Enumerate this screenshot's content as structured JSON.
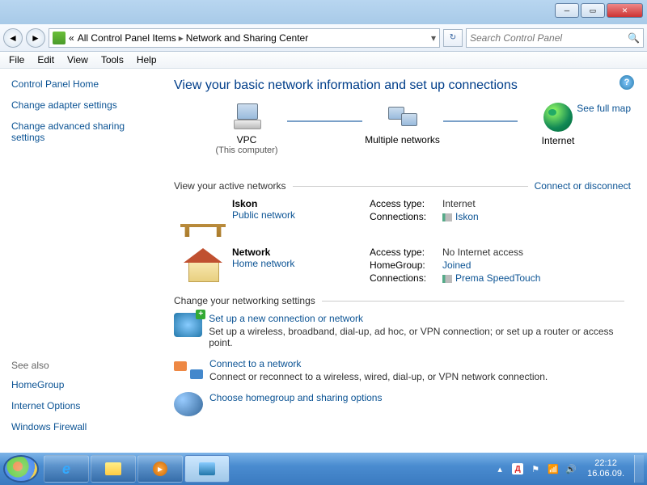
{
  "window": {
    "breadcrumb_prefix": "«",
    "breadcrumb_1": "All Control Panel Items",
    "breadcrumb_sep": "▸",
    "breadcrumb_2": "Network and Sharing Center",
    "search_placeholder": "Search Control Panel"
  },
  "menu": {
    "file": "File",
    "edit": "Edit",
    "view": "View",
    "tools": "Tools",
    "help": "Help"
  },
  "sidebar": {
    "home": "Control Panel Home",
    "adapter": "Change adapter settings",
    "advanced": "Change advanced sharing settings",
    "seealso": "See also",
    "homegroup": "HomeGroup",
    "inetopts": "Internet Options",
    "firewall": "Windows Firewall"
  },
  "content": {
    "heading": "View your basic network information and set up connections",
    "fullmap": "See full map",
    "map": {
      "pc_name": "VPC",
      "pc_sub": "(This computer)",
      "middle": "Multiple networks",
      "internet": "Internet"
    },
    "active_title": "View your active networks",
    "connect_link": "Connect or disconnect",
    "net1": {
      "name": "Iskon",
      "type": "Public network",
      "access_k": "Access type:",
      "access_v": "Internet",
      "conn_k": "Connections:",
      "conn_v": "Iskon"
    },
    "net2": {
      "name": "Network",
      "type": "Home network",
      "access_k": "Access type:",
      "access_v": "No Internet access",
      "hg_k": "HomeGroup:",
      "hg_v": "Joined",
      "conn_k": "Connections:",
      "conn_v": "Prema SpeedTouch"
    },
    "settings_title": "Change your networking settings",
    "s1_title": "Set up a new connection or network",
    "s1_desc": "Set up a wireless, broadband, dial-up, ad hoc, or VPN connection; or set up a router or access point.",
    "s2_title": "Connect to a network",
    "s2_desc": "Connect or reconnect to a wireless, wired, dial-up, or VPN network connection.",
    "s3_title": "Choose homegroup and sharing options"
  },
  "tray": {
    "time": "22:12",
    "date": "16.06.09."
  }
}
